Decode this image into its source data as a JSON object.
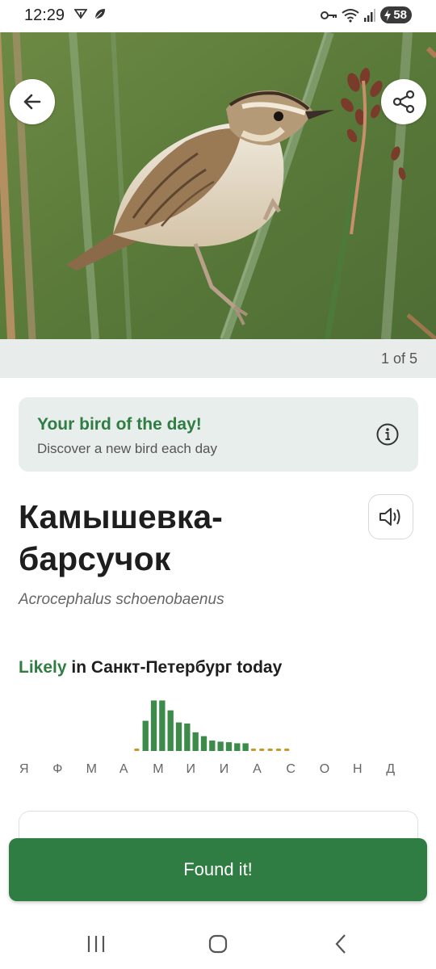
{
  "status_bar": {
    "time": "12:29",
    "battery": "58",
    "icons": [
      "data-saver-icon",
      "leaf-icon",
      "key-icon",
      "wifi-icon",
      "signal-icon",
      "battery-icon"
    ]
  },
  "hero": {
    "image": "bird-photo",
    "pager": "1 of 5",
    "back_icon": "arrow-left-icon",
    "share_icon": "share-icon"
  },
  "bird_of_day": {
    "title": "Your bird of the day!",
    "subtitle": "Discover a new bird each day",
    "icon": "info-icon"
  },
  "species": {
    "common_name": "Камышевка-барсучок",
    "scientific_name": "Acrocephalus schoenobaenus",
    "sound_icon": "speaker-icon"
  },
  "likelihood": {
    "word": "Likely",
    "rest": " in Санкт-Петербург today"
  },
  "chart_data": {
    "type": "bar",
    "categories": [
      "Я",
      "Ф",
      "М",
      "А",
      "М",
      "И",
      "И",
      "А",
      "С",
      "О",
      "Н",
      "Д"
    ],
    "bins_per_month": 4,
    "values": [
      0,
      0,
      0,
      0,
      0,
      0,
      0,
      0,
      0,
      0,
      0,
      0,
      0,
      0,
      0,
      0.05,
      0.55,
      0.92,
      0.92,
      0.74,
      0.52,
      0.5,
      0.34,
      0.27,
      0.19,
      0.17,
      0.16,
      0.14,
      0.14,
      0.05,
      0.05,
      0.03,
      0.03,
      0.03,
      0,
      0,
      0,
      0,
      0,
      0,
      0,
      0,
      0,
      0,
      0,
      0,
      0,
      0
    ],
    "colors": {
      "high": "#3d8b4a",
      "low": "#c49a2c"
    },
    "low_threshold": 0.1
  },
  "actions": {
    "found_label": "Found it!"
  },
  "nav": {
    "icons": [
      "recent-apps-icon",
      "home-icon",
      "back-icon"
    ]
  }
}
